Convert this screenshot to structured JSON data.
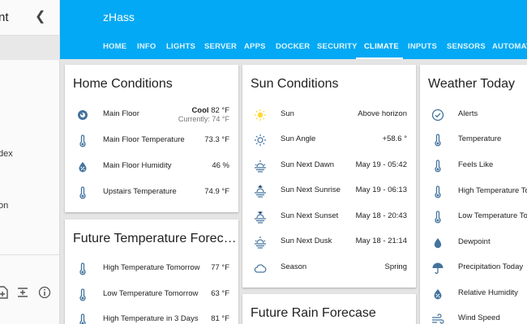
{
  "sidebar": {
    "title_fragment": "nt",
    "items": [
      "dex",
      "on"
    ]
  },
  "header": {
    "app_title": "zHass",
    "tabs": [
      "HOME",
      "INFO",
      "LIGHTS",
      "SERVER",
      "APPS",
      "DOCKER",
      "SECURITY",
      "CLIMATE",
      "INPUTS",
      "SENSORS",
      "AUTOMATI"
    ],
    "active_tab": "CLIMATE"
  },
  "cards": {
    "home": {
      "title": "Home Conditions",
      "thermostat": {
        "label": "Main Floor",
        "mode": "Cool",
        "target": "82 °F",
        "current": "Currently: 74 °F"
      },
      "rows": [
        {
          "label": "Main Floor Temperature",
          "value": "73.3 °F"
        },
        {
          "label": "Main Floor Humidity",
          "value": "46 %"
        },
        {
          "label": "Upstairs Temperature",
          "value": "74.9 °F"
        }
      ]
    },
    "future_temp": {
      "title": "Future Temperature Forec…",
      "rows": [
        {
          "label": "High Temperature Tomorrow",
          "value": "77 °F"
        },
        {
          "label": "Low Temperature Tomorrow",
          "value": "63 °F"
        },
        {
          "label": "High Temperature in 3 Days",
          "value": "81 °F"
        }
      ]
    },
    "sun": {
      "title": "Sun Conditions",
      "rows": [
        {
          "label": "Sun",
          "value": "Above horizon"
        },
        {
          "label": "Sun Angle",
          "value": "+58.6 °"
        },
        {
          "label": "Sun Next Dawn",
          "value": "May 19 - 05:42"
        },
        {
          "label": "Sun Next Sunrise",
          "value": "May 19 - 06:13"
        },
        {
          "label": "Sun Next Sunset",
          "value": "May 18 - 20:43"
        },
        {
          "label": "Sun Next Dusk",
          "value": "May 18 - 21:14"
        },
        {
          "label": "Season",
          "value": "Spring"
        }
      ]
    },
    "rain": {
      "title": "Future Rain Forecase"
    },
    "weather": {
      "title": "Weather Today",
      "rows": [
        {
          "label": "Alerts"
        },
        {
          "label": "Temperature"
        },
        {
          "label": "Feels Like"
        },
        {
          "label": "High Temperature To"
        },
        {
          "label": "Low Temperature To"
        },
        {
          "label": "Dewpoint"
        },
        {
          "label": "Precipitation Today"
        },
        {
          "label": "Relative Humidity"
        },
        {
          "label": "Wind Speed"
        }
      ]
    }
  },
  "colors": {
    "header": "#03a9f4",
    "icon": "#44739e",
    "sun": "#fdd835"
  }
}
